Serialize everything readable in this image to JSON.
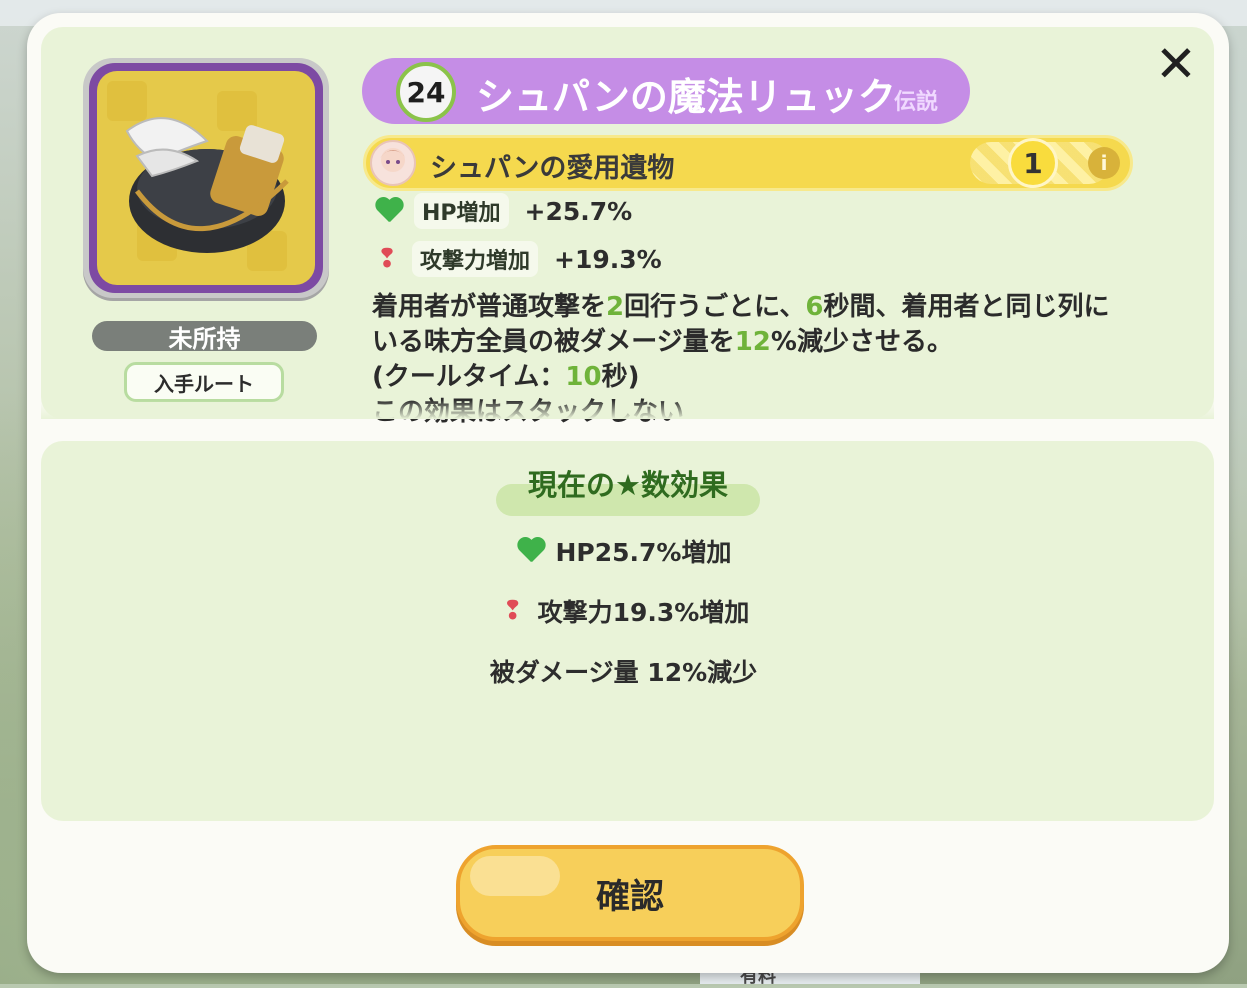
{
  "item": {
    "level": "24",
    "name": "シュパンの魔法リュック",
    "rarity": "伝説",
    "owner_label": "シュパンの愛用遺物",
    "count": "1",
    "info_icon": "i",
    "ownership_status": "未所持",
    "route_button_label": "入手ルート"
  },
  "stats": [
    {
      "label": "HP増加",
      "value": "+25.7%",
      "icon": "heart-icon"
    },
    {
      "label": "攻撃力増加",
      "value": "+19.3%",
      "icon": "attack-icon"
    }
  ],
  "description": {
    "p1": "着用者が普通攻撃を",
    "n1": "2",
    "p2": "回行うごとに、",
    "n2": "6",
    "p3": "秒間、着用者と同じ列にいる味方全員の被ダメージ量を",
    "n3": "12",
    "p4": "%減少させる。",
    "p5": "(クールタイム：",
    "n4": "10",
    "p6": "秒)",
    "p7": "この効果はスタックしない"
  },
  "current_effect": {
    "title": "現在の★数効果",
    "lines": [
      "HP25.7%増加",
      "攻撃力19.3%増加",
      "被ダメージ量 12%減少"
    ]
  },
  "buttons": {
    "close": "✕",
    "confirm": "確認"
  },
  "colors": {
    "title_bar": "#c58de6",
    "sub_bar": "#f5d94e",
    "panel_bg": "#e9f3d8",
    "highlight": "#6fb33a",
    "confirm": "#f7cf5a"
  },
  "background": {
    "bottom_label": "有料"
  }
}
